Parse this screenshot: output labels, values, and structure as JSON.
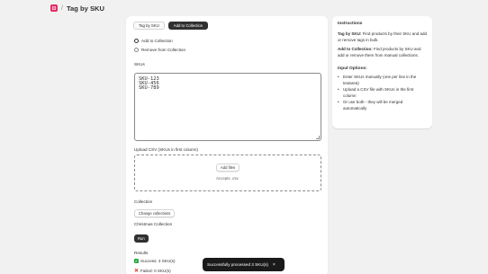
{
  "header": {
    "separator": "/",
    "title": "Tag by SKU"
  },
  "tabs": [
    {
      "label": "Tag by SKU",
      "active": false
    },
    {
      "label": "Add to Collection",
      "active": true
    }
  ],
  "mode": {
    "options": [
      {
        "label": "Add to Collection",
        "selected": true
      },
      {
        "label": "Remove from Collection",
        "selected": false
      }
    ]
  },
  "skus": {
    "label": "SKUs",
    "lines": [
      "SKU-123",
      "SKU-456",
      "SKU-789"
    ]
  },
  "upload": {
    "label": "Upload CSV (SKUs in first column)",
    "add_files_label": "Add files",
    "accepts_text": "Accepts .csv"
  },
  "collection": {
    "label": "Collection",
    "change_button": "Change collections",
    "selected_name": "Christmas Collection"
  },
  "run_label": "Run",
  "results": {
    "label": "Results",
    "success_text": "Success: 3 SKU(s)",
    "failed_text": "Failed: 0 SKU(s)"
  },
  "toast": {
    "message": "Successfully processed 3 SKU(s)"
  },
  "instructions": {
    "title": "Instructions",
    "p1_bold": "Tag by SKU:",
    "p1_text": " Find products by their SKU and add or remove tags in bulk.",
    "p2_bold": "Add to Collection:",
    "p2_text": " Find products by SKU and add or remove them from manual collections.",
    "input_title": "Input Options:",
    "bullets": [
      "Enter SKUs manually (one per line in the textarea)",
      "Upload a CSV file with SKUs in the first column",
      "Or use both - they will be merged automatically"
    ]
  },
  "colors": {
    "accent": "#303030",
    "success": "#29a845",
    "danger": "#d72c0d",
    "app_icon": "#e0245e"
  }
}
